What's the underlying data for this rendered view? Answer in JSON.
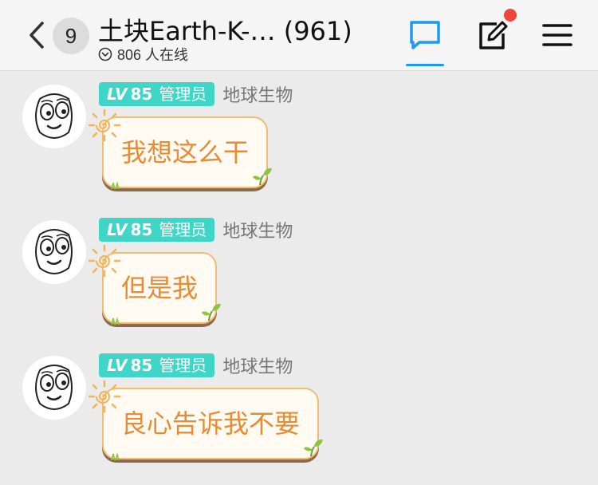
{
  "header": {
    "back_count": "9",
    "title": "土块Earth-K-… (961)",
    "online_text": "806 人在线",
    "icons": [
      "chevron-left-icon",
      "chat-bubble-icon",
      "edit-icon",
      "menu-icon"
    ],
    "colors": {
      "accent": "#1e9aef",
      "notify": "#f0473c"
    }
  },
  "messages": [
    {
      "level_prefix": "LV",
      "level_num": "85",
      "role": "管理员",
      "sender": "地球生物",
      "text": "我想这么干"
    },
    {
      "level_prefix": "LV",
      "level_num": "85",
      "role": "管理员",
      "sender": "地球生物",
      "text": "但是我"
    },
    {
      "level_prefix": "LV",
      "level_num": "85",
      "role": "管理员",
      "sender": "地球生物",
      "text": "良心告诉我不要"
    }
  ],
  "colors": {
    "role_badge": "#3fd6c7",
    "bubble_text": "#e78b35",
    "bubble_border": "#f2bd70"
  }
}
